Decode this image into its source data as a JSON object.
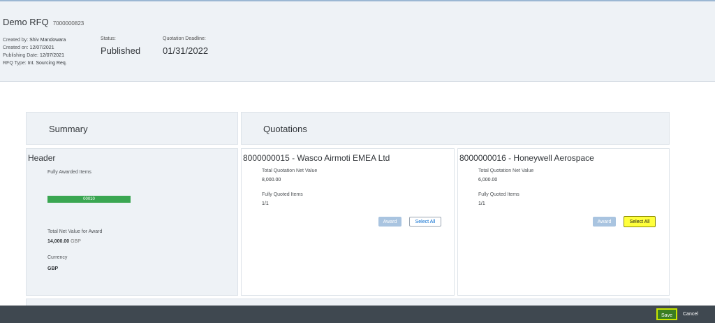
{
  "header": {
    "title": "Demo RFQ",
    "rfq_number": "7000000823",
    "created_by_label": "Created by:",
    "created_by": "Shiv Mandowara",
    "created_on_label": "Created on:",
    "created_on": "12/07/2021",
    "publishing_date_label": "Publishing Date:",
    "publishing_date": "12/07/2021",
    "rfq_type_label": "RFQ Type:",
    "rfq_type": "Int. Sourcing Req.",
    "status_label": "Status:",
    "status": "Published",
    "deadline_label": "Quotation Deadline:",
    "deadline": "01/31/2022"
  },
  "summary": {
    "title": "Summary",
    "header_label": "Header",
    "fully_awarded_label": "Fully Awarded Items",
    "item_bar_label": "00010",
    "total_net_label": "Total Net Value for Award",
    "total_net_value": "14,000.00",
    "total_net_currency": "GBP",
    "currency_label": "Currency",
    "currency_value": "GBP"
  },
  "quotations": {
    "title": "Quotations",
    "cards": [
      {
        "title": "8000000015 - Wasco Airmoti EMEA Ltd",
        "net_value_label": "Total Quotation Net Value",
        "net_value": "8,000.00",
        "quoted_items_label": "Fully Quoted Items",
        "quoted_items": "1/1",
        "award_label": "Award",
        "select_all_label": "Select All"
      },
      {
        "title": "8000000016 - Honeywell Aerospace",
        "net_value_label": "Total Quotation Net Value",
        "net_value": "6,000.00",
        "quoted_items_label": "Fully Quoted Items",
        "quoted_items": "1/1",
        "award_label": "Award",
        "select_all_label": "Select All"
      }
    ]
  },
  "footer": {
    "save_label": "Save",
    "cancel_label": "Cancel"
  },
  "colors": {
    "highlight": "#ffff3c",
    "progress_bar": "#3aa651",
    "footer_bg": "#3f4850"
  }
}
